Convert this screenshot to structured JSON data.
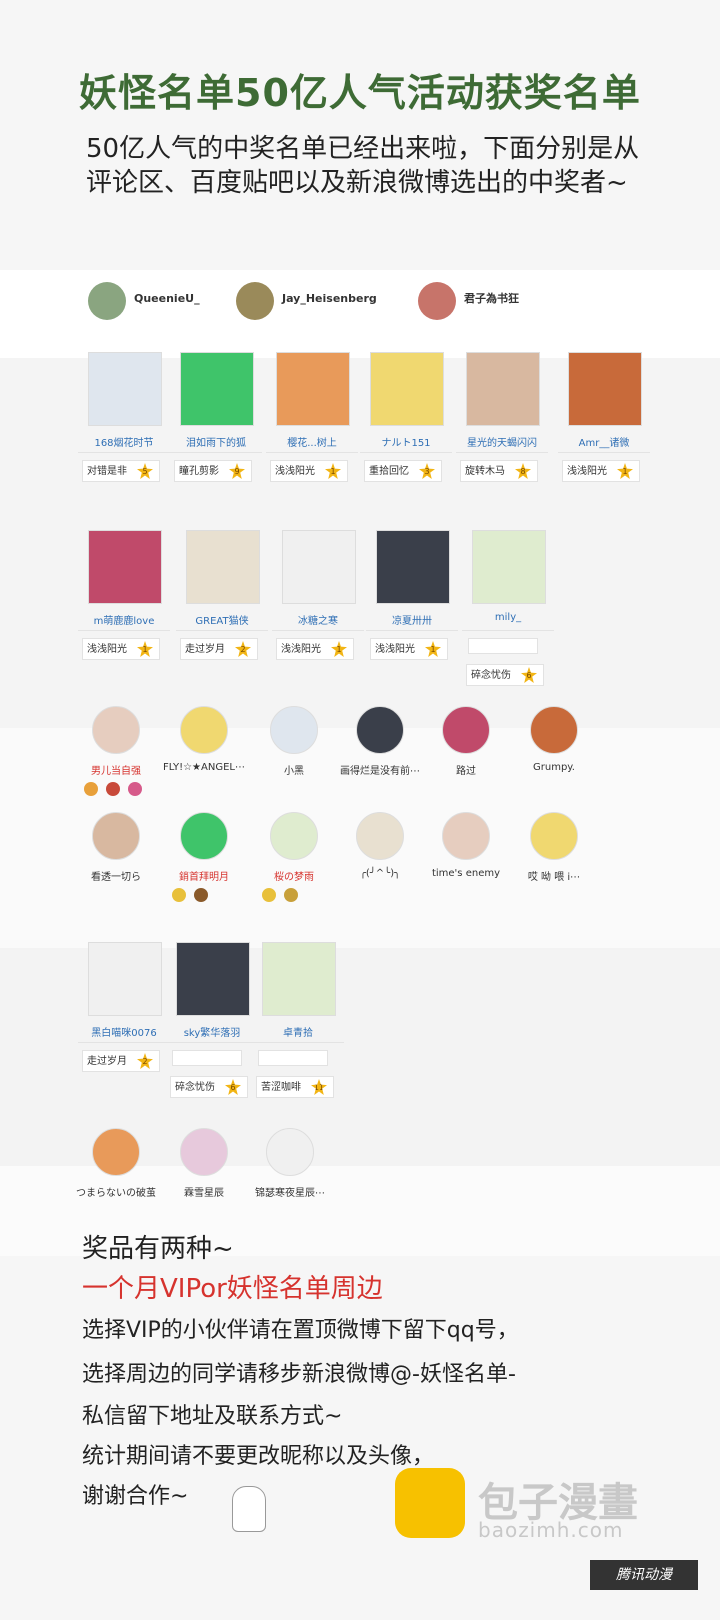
{
  "title": "妖怪名单50亿人气活动获奖名单",
  "intro": "50亿人气的中奖名单已经出来啦，下面分别是从评论区、百度贴吧以及新浪微博选出的中奖者~",
  "header_users": [
    {
      "name": "QueenieU_"
    },
    {
      "name": "Jay_Heisenberg"
    },
    {
      "name": "君子為书狂"
    }
  ],
  "tiles_row1": [
    {
      "name": "168烟花时节",
      "badge": "对错是非",
      "level": "5"
    },
    {
      "name": "泪如雨下的狐",
      "badge": "瞳孔剪影",
      "level": "9"
    },
    {
      "name": "樱花...树上",
      "badge": "浅浅阳光",
      "level": "1"
    },
    {
      "name": "ナルト151",
      "badge": "重拾回忆",
      "level": "3"
    },
    {
      "name": "星光的天蝎闪闪",
      "badge": "旋转木马",
      "level": "8"
    },
    {
      "name": "Amr__诸微",
      "badge": "浅浅阳光",
      "level": "1"
    }
  ],
  "tiles_row2": [
    {
      "name": "m萌鹿鹿love",
      "badge": "浅浅阳光",
      "level": "1"
    },
    {
      "name": "GREAT猫侠",
      "badge": "走过岁月",
      "level": "2"
    },
    {
      "name": "冰糖之寒",
      "badge": "浅浅阳光",
      "level": "1"
    },
    {
      "name": "凉夏卅卅",
      "badge": "浅浅阳光",
      "level": "1"
    },
    {
      "name": "mily_",
      "badge": "碎念忧伤",
      "level": "6"
    }
  ],
  "round_row1": [
    {
      "name": "男儿当自强",
      "red": true
    },
    {
      "name": "FLY!☆★ANGEL⋯",
      "red": false
    },
    {
      "name": "小黑",
      "red": false
    },
    {
      "name": "画得烂是没有前⋯",
      "red": false
    },
    {
      "name": "路过",
      "red": false
    },
    {
      "name": "Grumpy.",
      "red": false
    }
  ],
  "round_row2": [
    {
      "name": "看透一切ら",
      "red": false
    },
    {
      "name": "銷首拜明月",
      "red": true
    },
    {
      "name": "桜の梦雨",
      "red": true
    },
    {
      "name": "╭(╯^╰)╮",
      "red": false
    },
    {
      "name": "time's enemy",
      "red": false
    },
    {
      "name": "哎 呦 喂 i⋯",
      "red": false
    }
  ],
  "tiles_row3": [
    {
      "name": "黑白喵咪0076",
      "badge": "走过岁月",
      "level": "2"
    },
    {
      "name": "sky繁华落羽",
      "badge": "碎念忧伤",
      "level": "6"
    },
    {
      "name": "卓青拾",
      "badge": "苦涩咖啡",
      "level": "11"
    }
  ],
  "round_row3": [
    {
      "name": "つまらないの破茧"
    },
    {
      "name": "霖雪星辰"
    },
    {
      "name": "锦瑟寒夜星辰⋯"
    }
  ],
  "prize_lines": [
    {
      "text": "奖品有两种~",
      "red": false
    },
    {
      "text": "一个月VIPor妖怪名单周边",
      "red": true
    },
    {
      "text": "选择VIP的小伙伴请在置顶微博下留下qq号，",
      "red": false
    },
    {
      "text": "选择周边的同学请移步新浪微博@-妖怪名单-",
      "red": false
    },
    {
      "text": "私信留下地址及联系方式~",
      "red": false
    },
    {
      "text": "统计期间请不要更改昵称以及头像，",
      "red": false
    },
    {
      "text": "谢谢合作~",
      "red": false
    }
  ],
  "watermark": {
    "text": "包子漫畫",
    "url": "baozimh.com",
    "tag": "腾讯动漫"
  },
  "colors": {
    "title": "#3e6b35",
    "accent_red": "#d6332e",
    "link_blue": "#2f6fb5",
    "star": "#f2b514"
  }
}
